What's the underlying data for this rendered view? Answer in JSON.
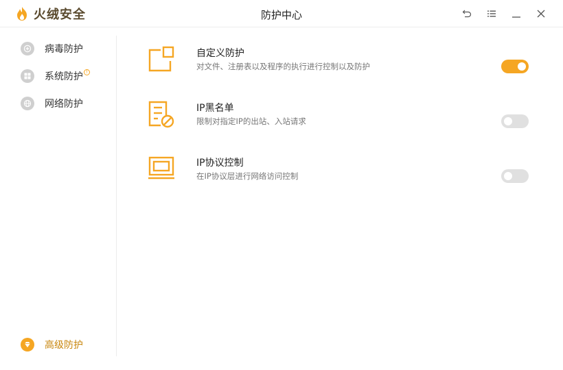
{
  "app": {
    "brand_name": "火绒安全",
    "window_title": "防护中心",
    "accent_color": "#f5a623"
  },
  "window_controls": [
    {
      "name": "back",
      "icon": "undo-arrow-icon"
    },
    {
      "name": "menu",
      "icon": "list-menu-icon"
    },
    {
      "name": "minimize",
      "icon": "minimize-icon"
    },
    {
      "name": "close",
      "icon": "close-icon"
    }
  ],
  "sidebar": {
    "items": [
      {
        "label": "病毒防护",
        "icon": "plus-shield-icon"
      },
      {
        "label": "系统防护",
        "icon": "windows-icon",
        "badge": "!"
      },
      {
        "label": "网络防护",
        "icon": "network-icon"
      }
    ],
    "premium": {
      "label": "高级防护",
      "icon": "diamond-icon"
    }
  },
  "features": [
    {
      "title": "自定义防护",
      "desc": "对文件、注册表以及程序的执行进行控制以及防护",
      "icon": "custom-rule-icon",
      "enabled": true
    },
    {
      "title": "IP黑名单",
      "desc": "限制对指定IP的出站、入站请求",
      "icon": "blacklist-icon",
      "enabled": false
    },
    {
      "title": "IP协议控制",
      "desc": "在IP协议层进行网络访问控制",
      "icon": "laptop-icon",
      "enabled": false
    }
  ]
}
